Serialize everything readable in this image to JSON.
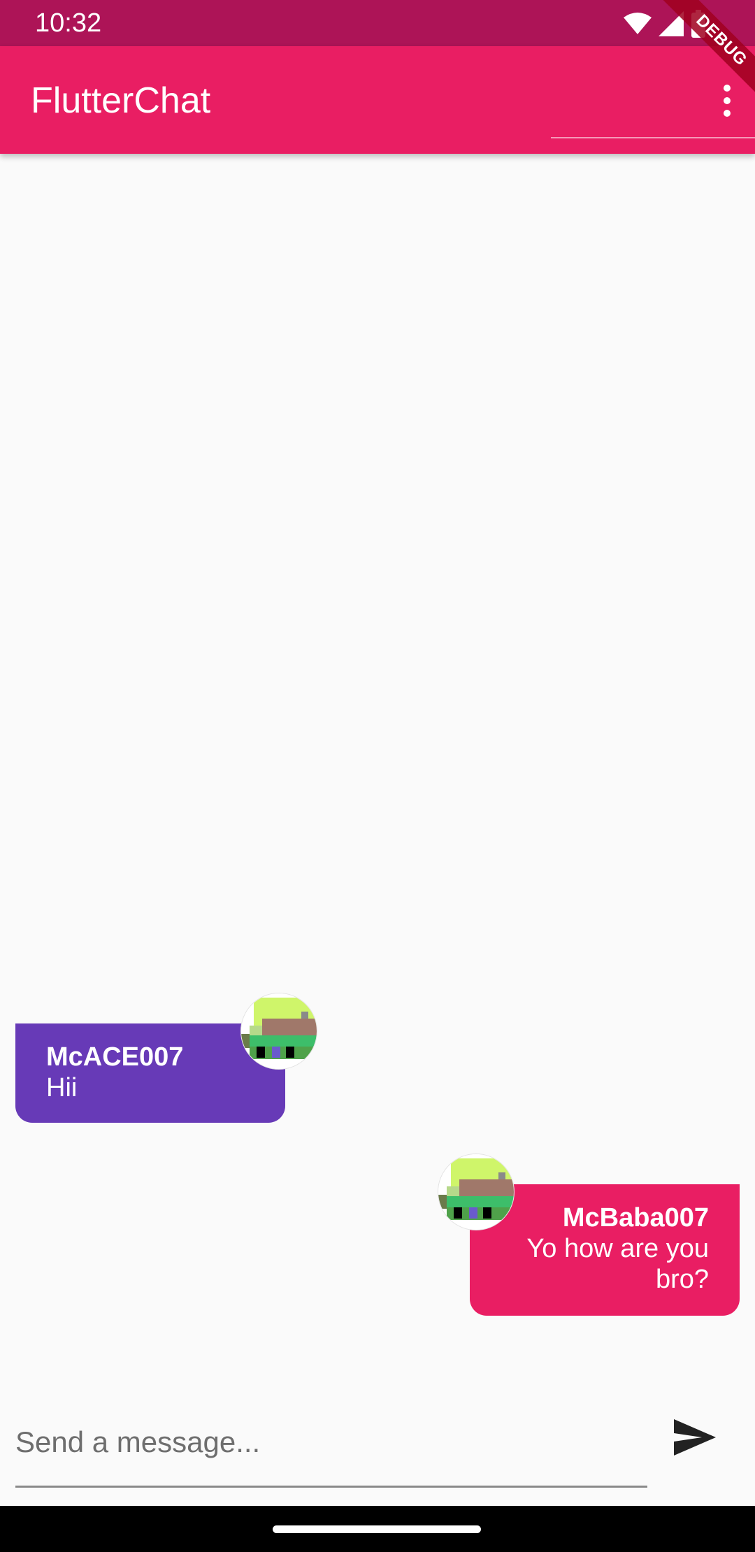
{
  "status_bar": {
    "time": "10:32",
    "icons": [
      "wifi-icon",
      "signal-icon",
      "battery-icon"
    ]
  },
  "app_bar": {
    "title": "FlutterChat",
    "menu_icon": "more-vert-icon",
    "debug_banner": "DEBUG"
  },
  "messages": [
    {
      "username": "McACE007",
      "text": "Hii",
      "side": "left",
      "bubble_color": "#673AB7",
      "avatar": "pixel-avatar"
    },
    {
      "username": "McBaba007",
      "text": "Yo how are you bro?",
      "side": "right",
      "bubble_color": "#E91E63",
      "avatar": "pixel-avatar"
    }
  ],
  "composer": {
    "placeholder": "Send a message...",
    "value": "",
    "send_icon": "send-icon"
  },
  "colors": {
    "primary": "#E91E63",
    "primary_dark": "#AD1457",
    "accent": "#673AB7",
    "background": "#FAFAFA"
  }
}
